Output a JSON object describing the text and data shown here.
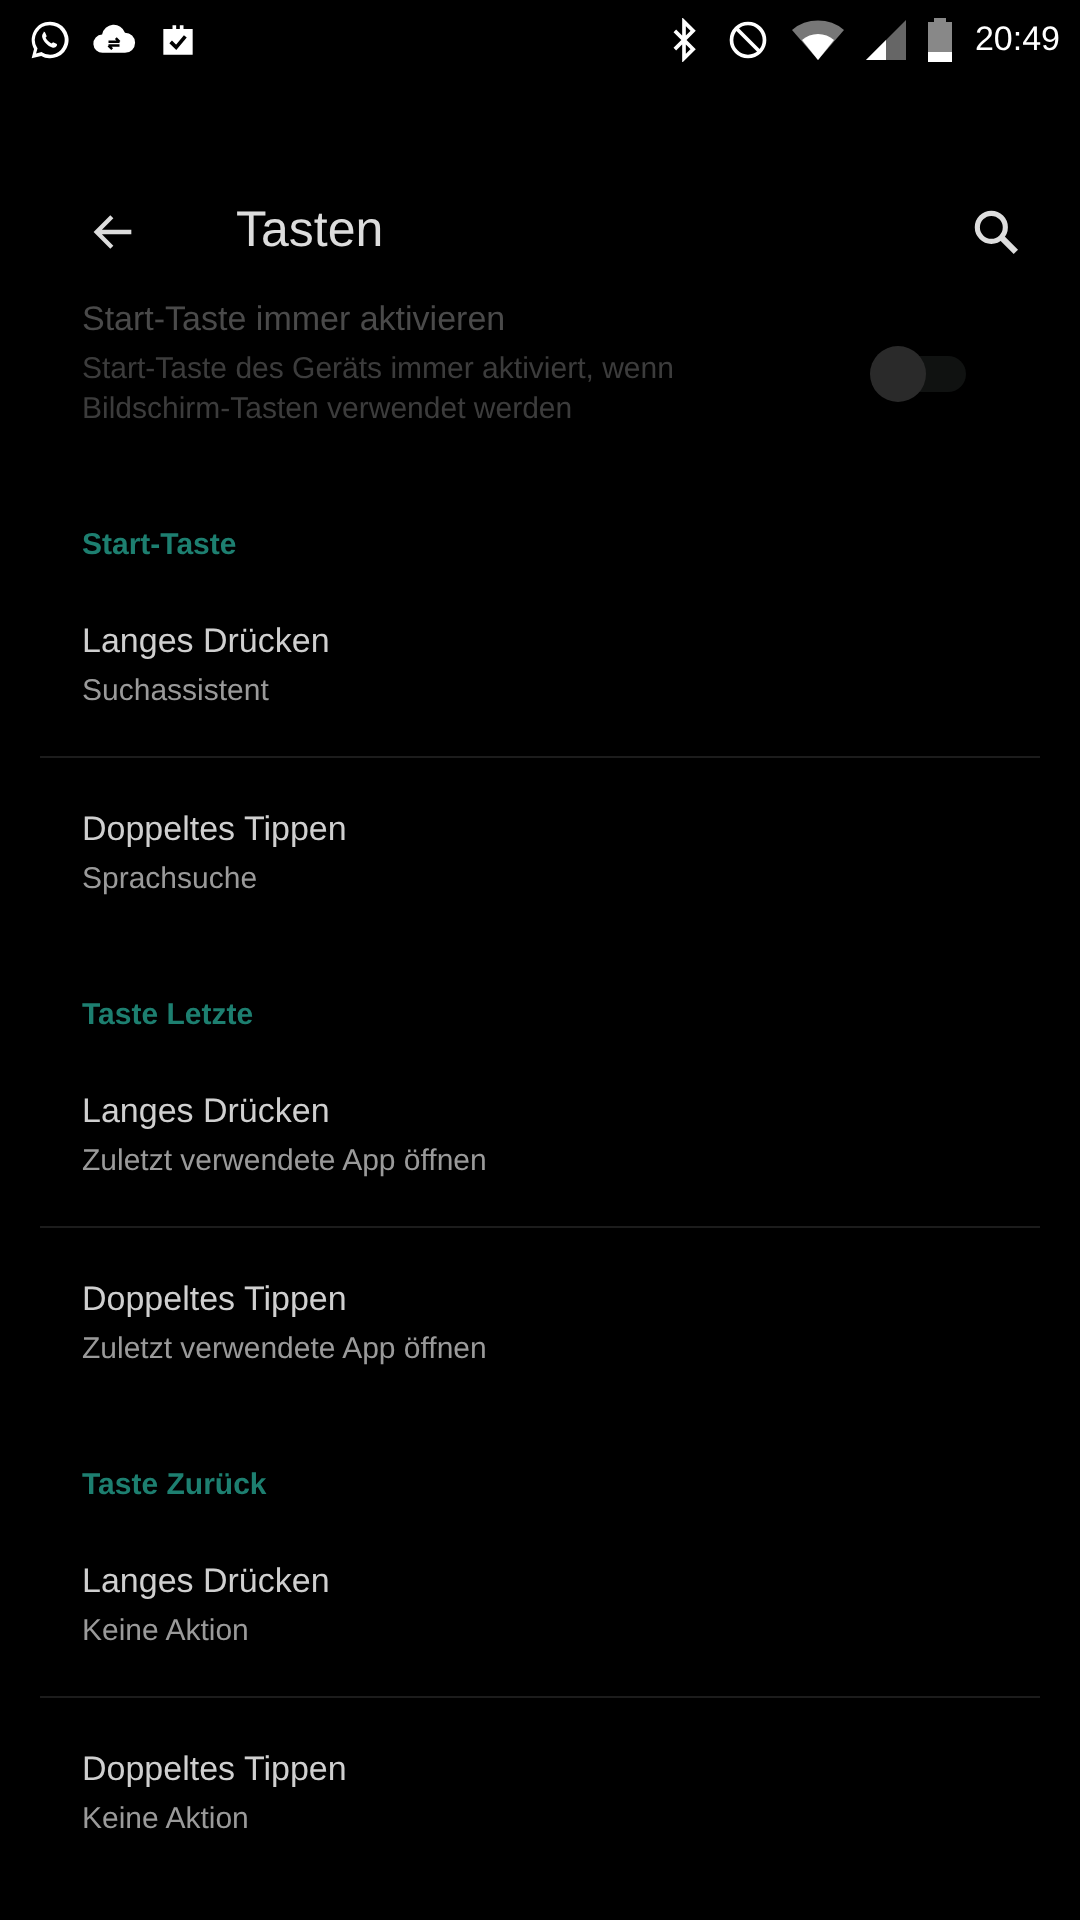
{
  "status_bar": {
    "time": "20:49"
  },
  "toolbar": {
    "title": "Tasten"
  },
  "partial_item": {
    "title": "Start-Taste immer aktivieren",
    "subtitle": "Start-Taste des Geräts immer aktiviert, wenn Bildschirm-Tasten verwendet werden",
    "on": false,
    "disabled": true
  },
  "sections": [
    {
      "header": "Start-Taste",
      "items": [
        {
          "title": "Langes Drücken",
          "subtitle": "Suchassistent"
        },
        {
          "title": "Doppeltes Tippen",
          "subtitle": "Sprachsuche"
        }
      ]
    },
    {
      "header": "Taste Letzte",
      "items": [
        {
          "title": "Langes Drücken",
          "subtitle": "Zuletzt verwendete App öffnen"
        },
        {
          "title": "Doppeltes Tippen",
          "subtitle": "Zuletzt verwendete App öffnen"
        }
      ]
    },
    {
      "header": "Taste Zurück",
      "items": [
        {
          "title": "Langes Drücken",
          "subtitle": "Keine Aktion"
        },
        {
          "title": "Doppeltes Tippen",
          "subtitle": "Keine Aktion"
        }
      ]
    }
  ]
}
